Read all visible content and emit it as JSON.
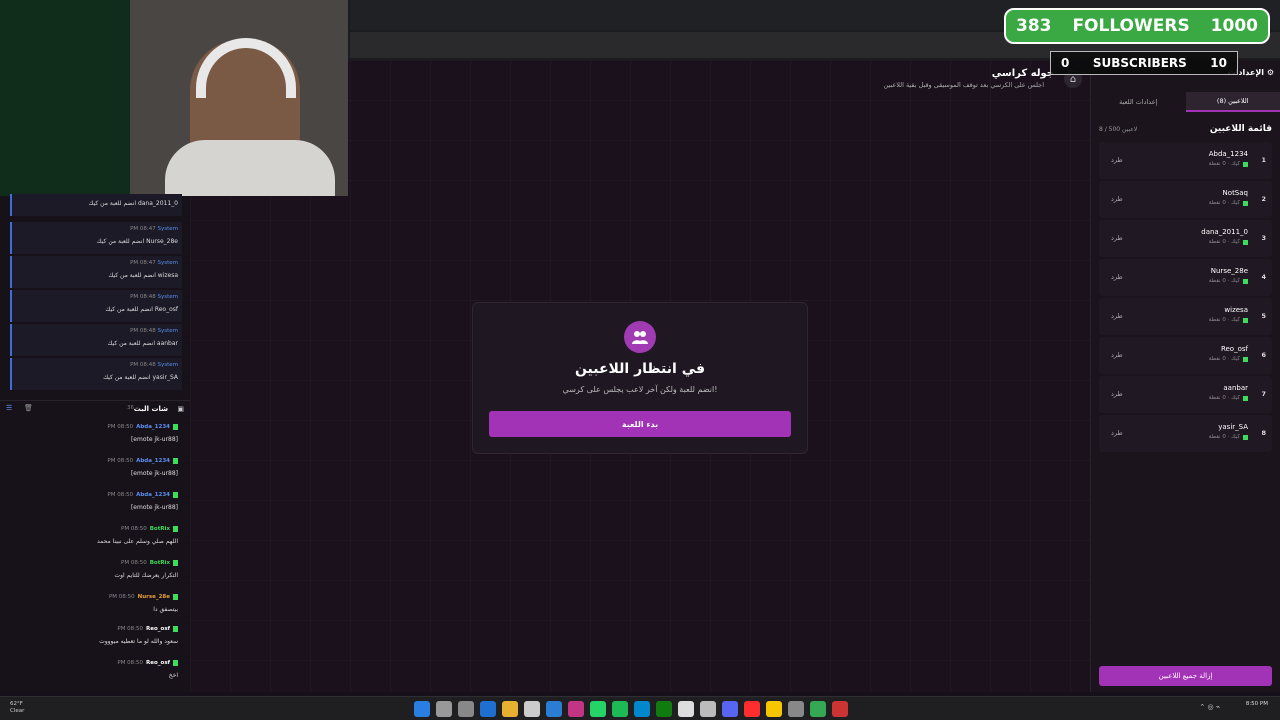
{
  "overlay": {
    "followers_current": "383",
    "followers_label": "FOLLOWERS",
    "followers_goal": "1000",
    "subscribers_current": "0",
    "subscribers_label": "SUBSCRIBERS",
    "subscribers_goal": "10"
  },
  "game": {
    "title": "جوله كراسي",
    "subtitle": "اجلس على الكرسي بعد توقف الموسيقى وقبل بقية اللاعبين",
    "waiting_title": "في انتظار اللاعبين",
    "waiting_sub": "انضم للعبة ولكن آخر لاعب يجلس على كرسي!",
    "start_button": "بدء اللعبة"
  },
  "right_panel": {
    "settings_label": "الإعدادات",
    "tab_players": "اللاعبين (8)",
    "tab_game_settings": "إعدادات اللعبة",
    "list_title": "قائمة اللاعبين",
    "list_count": "8 / 500 لاعبين",
    "kick_label": "طرد",
    "meta_label": "كيك · 0 نقطة",
    "clear_all": "إزالة جميع اللاعبين",
    "players": [
      {
        "num": "1",
        "name": "Abda_1234"
      },
      {
        "num": "2",
        "name": "NotSaq"
      },
      {
        "num": "3",
        "name": "dana_2011_0"
      },
      {
        "num": "4",
        "name": "Nurse_28e"
      },
      {
        "num": "5",
        "name": "wizesa"
      },
      {
        "num": "6",
        "name": "Reo_osf"
      },
      {
        "num": "7",
        "name": "aanbar"
      },
      {
        "num": "8",
        "name": "yasir_SA"
      }
    ]
  },
  "system_feed": [
    {
      "time": "",
      "text": "انضم للعبة من كيك dana_2011_0"
    },
    {
      "time": "PM 08:47",
      "text": "انضم للعبة من كيك Nurse_28e"
    },
    {
      "time": "PM 08:47",
      "text": "انضم للعبة من كيك wizesa"
    },
    {
      "time": "PM 08:48",
      "text": "انضم للعبة من كيك Reo_osf"
    },
    {
      "time": "PM 08:48",
      "text": "انضم للعبة من كيك aanbar"
    },
    {
      "time": "PM 08:48",
      "text": "انضم للعبة من كيك yasir_SA"
    }
  ],
  "system_name": "System",
  "chat": {
    "title": "شات البث",
    "count": "36",
    "messages": [
      {
        "time": "PM 08:50",
        "user": "Abda_1234",
        "color": "#5b8ef0",
        "text": "[emote   jk-ur88]"
      },
      {
        "time": "PM 08:50",
        "user": "Abda_1234",
        "color": "#5b8ef0",
        "text": "[emote   jk-ur88]"
      },
      {
        "time": "PM 08:50",
        "user": "Abda_1234",
        "color": "#5b8ef0",
        "text": "[emote   jk-ur88]"
      },
      {
        "time": "PM 08:50",
        "user": "BotRix",
        "color": "#3ddc5b",
        "text": "اللهم صلي وسلم على نبينا محمد"
      },
      {
        "time": "PM 08:50",
        "user": "BotRix",
        "color": "#3ddc5b",
        "text": "التكرار يعرضك للتايم اوت"
      },
      {
        "time": "PM 08:50",
        "user": "Nurse_28e",
        "color": "#e8a13a",
        "text": "بيتصفق دا"
      },
      {
        "time": "PM 08:50",
        "user": "Reo_osf",
        "color": "#ffffff",
        "text": "سعود والله لو ما تعطيه ميوووت"
      },
      {
        "time": "PM 08:50",
        "user": "Reo_osf",
        "color": "#ffffff",
        "text": "اخخ"
      }
    ]
  },
  "taskbar": {
    "weather_temp": "62°F",
    "weather_desc": "Clear",
    "clock_time": "8:50 PM",
    "clock_date": "",
    "icon_colors": [
      "#2a7de1",
      "#999999",
      "#888888",
      "#1f6fd1",
      "#e8b030",
      "#cccccc",
      "#2b7cd3",
      "#c13584",
      "#25d366",
      "#1db954",
      "#0088cc",
      "#107c10",
      "#dddddd",
      "#bbbbbb",
      "#5865f2",
      "#ff2d2d",
      "#f7c600",
      "#888888",
      "#34a853",
      "#cc3333"
    ]
  }
}
